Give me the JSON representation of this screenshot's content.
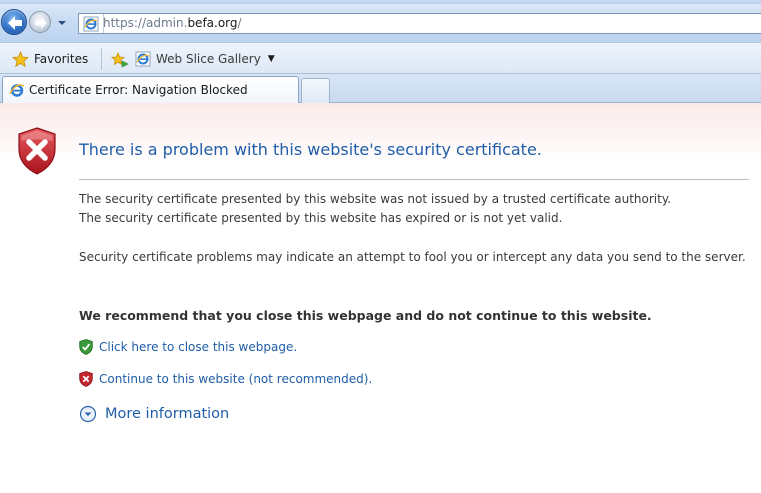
{
  "browser": {
    "address": {
      "prefix": "https://admin.",
      "domain": "befa.org",
      "suffix": "/"
    },
    "favorites_label": "Favorites",
    "web_slice_gallery_label": "Web Slice Gallery",
    "tab_title": "Certificate Error: Navigation Blocked"
  },
  "page": {
    "title": "There is a problem with this website's security certificate.",
    "paragraph1_line1": "The security certificate presented by this website was not issued by a trusted certificate authority.",
    "paragraph1_line2": "The security certificate presented by this website has expired or is not yet valid.",
    "paragraph2": "Security certificate problems may indicate an attempt to fool you or intercept any data you send to the server.",
    "recommendation": "We recommend that you close this webpage and do not continue to this website.",
    "close_link": "Click here to close this webpage.",
    "continue_link": "Continue to this website (not recommended).",
    "more_info": "More information"
  },
  "colors": {
    "link": "#1f5da8",
    "error_red": "#c4262e",
    "safe_green": "#3c9a3c"
  }
}
